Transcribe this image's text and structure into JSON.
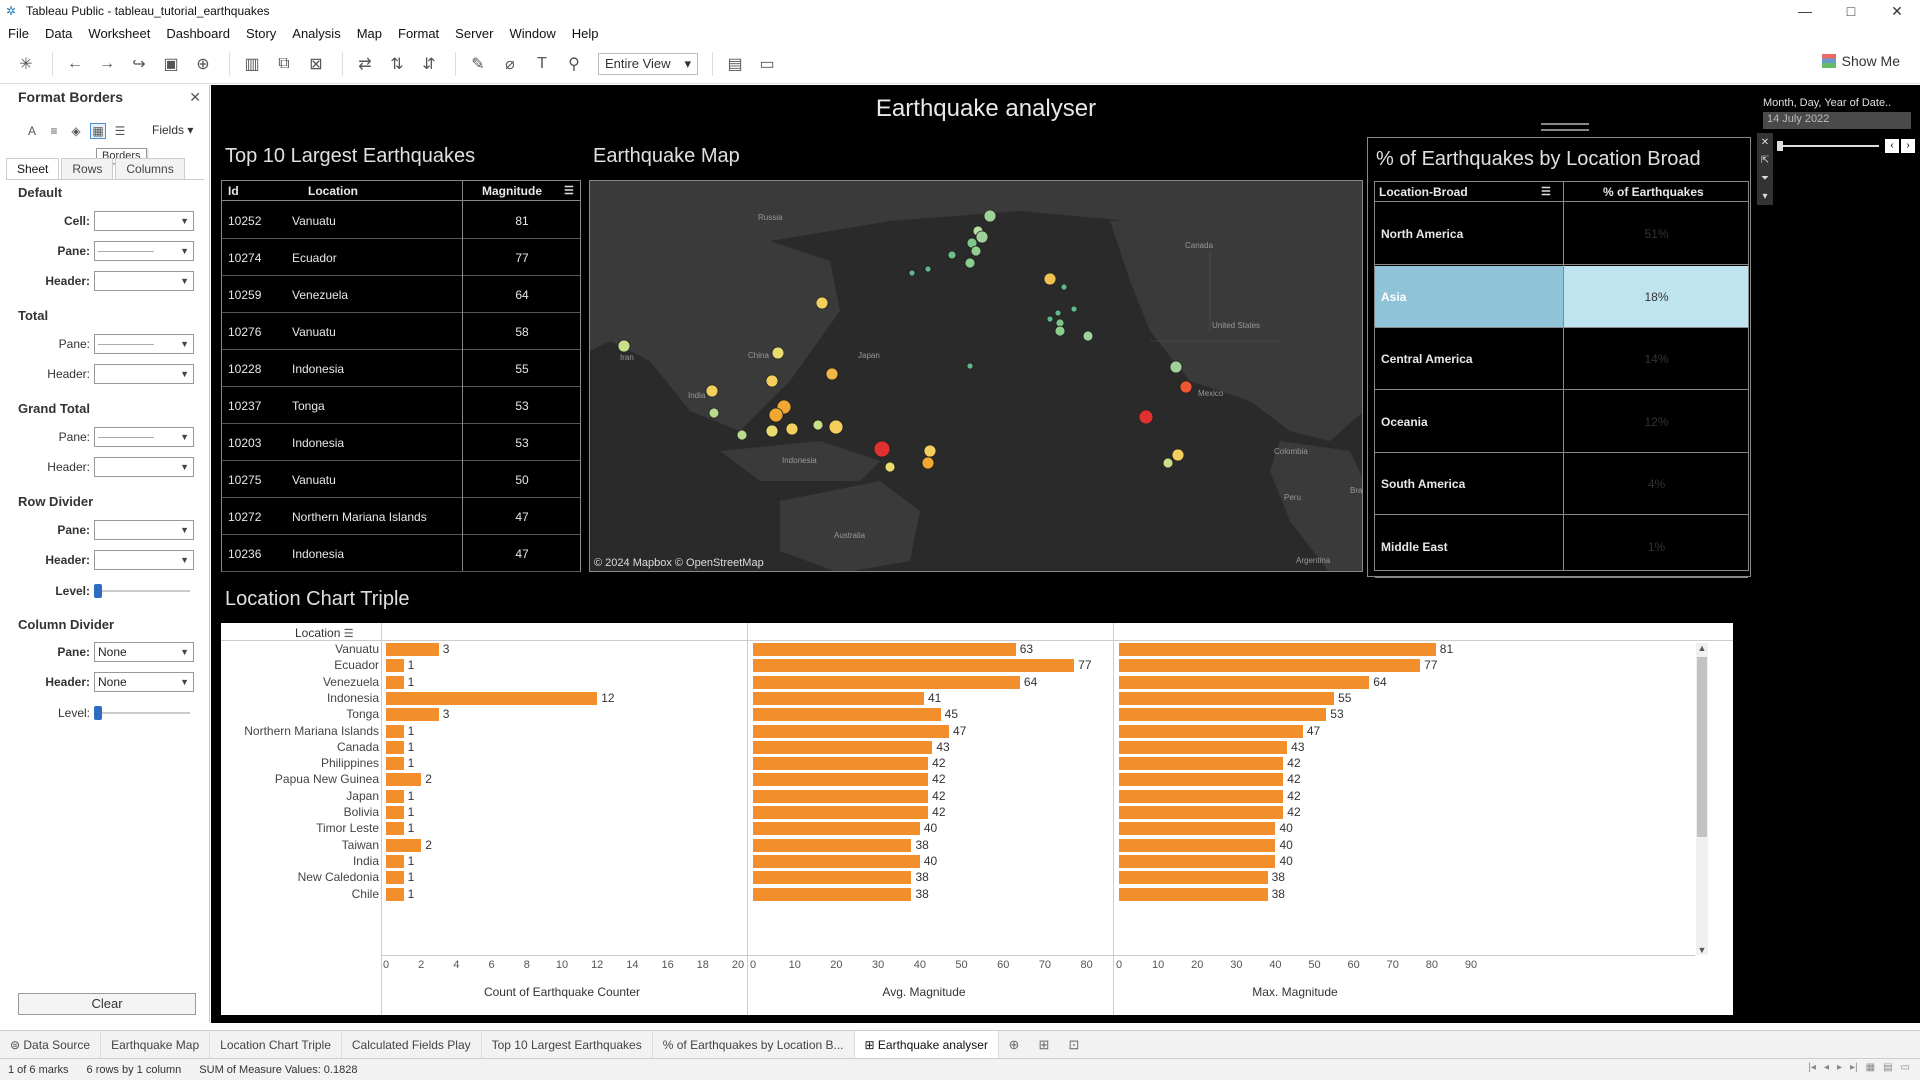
{
  "window": {
    "title": "Tableau Public - tableau_tutorial_earthquakes",
    "minimize": "—",
    "maximize": "□",
    "close": "✕"
  },
  "menu": [
    "File",
    "Data",
    "Worksheet",
    "Dashboard",
    "Story",
    "Analysis",
    "Map",
    "Format",
    "Server",
    "Window",
    "Help"
  ],
  "toolbar": {
    "fit_select": "Entire View",
    "show_me": "Show Me"
  },
  "format_panel": {
    "title": "Format Borders",
    "fields_label": "Fields",
    "tooltip": "Borders",
    "tabs": [
      "Sheet",
      "Rows",
      "Columns"
    ],
    "sections": {
      "default": "Default",
      "total": "Total",
      "grand_total": "Grand Total",
      "row_divider": "Row Divider",
      "column_divider": "Column Divider"
    },
    "labels": {
      "cell": "Cell:",
      "pane": "Pane:",
      "header": "Header:",
      "level": "Level:"
    },
    "column_divider_pane": "None",
    "column_divider_header": "None",
    "clear": "Clear"
  },
  "dashboard": {
    "title": "Earthquake analyser"
  },
  "top10": {
    "title": "Top 10 Largest Earthquakes",
    "headers": [
      "Id",
      "Location",
      "Magnitude"
    ],
    "rows": [
      [
        "10252",
        "Vanuatu",
        "81"
      ],
      [
        "10274",
        "Ecuador",
        "77"
      ],
      [
        "10259",
        "Venezuela",
        "64"
      ],
      [
        "10276",
        "Vanuatu",
        "58"
      ],
      [
        "10228",
        "Indonesia",
        "55"
      ],
      [
        "10237",
        "Tonga",
        "53"
      ],
      [
        "10203",
        "Indonesia",
        "53"
      ],
      [
        "10275",
        "Vanuatu",
        "50"
      ],
      [
        "10272",
        "Northern Mariana Islands",
        "47"
      ],
      [
        "10236",
        "Indonesia",
        "47"
      ]
    ]
  },
  "map": {
    "title": "Earthquake Map",
    "attribution": "© 2024 Mapbox © OpenStreetMap",
    "labels": [
      "Russia",
      "Canada",
      "China",
      "Japan",
      "India",
      "Iran",
      "United States",
      "Mexico",
      "Colombia",
      "Peru",
      "Australia",
      "Indonesia",
      "Argentina",
      "Bra"
    ]
  },
  "pct": {
    "title": "% of Earthquakes by Location Broad",
    "headers": [
      "Location-Broad",
      "% of Earthquakes"
    ],
    "rows": [
      {
        "location": "North America",
        "value": "51%"
      },
      {
        "location": "Asia",
        "value": "18%"
      },
      {
        "location": "Central America",
        "value": "14%"
      },
      {
        "location": "Oceania",
        "value": "12%"
      },
      {
        "location": "South America",
        "value": "4%"
      },
      {
        "location": "Middle East",
        "value": "1%"
      }
    ]
  },
  "date_filter": {
    "title": "Month, Day, Year of Date..",
    "value": "14 July 2022"
  },
  "chart_data": {
    "type": "bar",
    "title": "Location Chart Triple",
    "row_header": "Location",
    "categories": [
      "Vanuatu",
      "Ecuador",
      "Venezuela",
      "Indonesia",
      "Tonga",
      "Northern Mariana Islands",
      "Canada",
      "Philippines",
      "Papua New Guinea",
      "Japan",
      "Bolivia",
      "Timor Leste",
      "Taiwan",
      "India",
      "New Caledonia",
      "Chile"
    ],
    "series": [
      {
        "name": "Count of Earthquake Counter",
        "values": [
          3,
          1,
          1,
          12,
          3,
          1,
          1,
          1,
          2,
          1,
          1,
          1,
          2,
          1,
          1,
          1
        ],
        "ticks": [
          0,
          2,
          4,
          6,
          8,
          10,
          12,
          14,
          16,
          18,
          20
        ],
        "xlim": [
          0,
          20
        ]
      },
      {
        "name": "Avg. Magnitude",
        "values": [
          63,
          77,
          64,
          41,
          45,
          47,
          43,
          42,
          42,
          42,
          42,
          40,
          38,
          40,
          38,
          38
        ],
        "ticks": [
          0,
          10,
          20,
          30,
          40,
          50,
          60,
          70,
          80
        ],
        "xlim": [
          0,
          82
        ]
      },
      {
        "name": "Max. Magnitude",
        "values": [
          81,
          77,
          64,
          55,
          53,
          47,
          43,
          42,
          42,
          42,
          42,
          40,
          40,
          40,
          38,
          38
        ],
        "ticks": [
          0,
          10,
          20,
          30,
          40,
          50,
          60,
          70,
          80,
          90
        ],
        "xlim": [
          0,
          90
        ]
      }
    ],
    "bar_color": "#f28e2b"
  },
  "sheet_tabs": [
    "Data Source",
    "Earthquake Map",
    "Location Chart Triple",
    "Calculated Fields Play",
    "Top 10 Largest Earthquakes",
    "% of Earthquakes by Location B...",
    "Earthquake analyser"
  ],
  "status": {
    "marks": "1 of 6 marks",
    "dims": "6 rows by 1 column",
    "sum": "SUM of Measure Values: 0.1828"
  }
}
